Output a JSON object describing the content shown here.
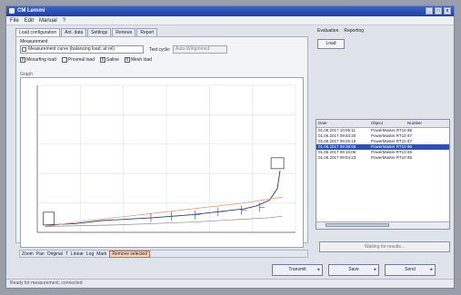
{
  "window": {
    "title": "CM Lemmi",
    "buttons": [
      "_",
      "□",
      "x"
    ]
  },
  "menu": {
    "items": [
      "File",
      "Edit",
      "Manual",
      "?"
    ]
  },
  "tabs": [
    {
      "label": "Load configuration"
    },
    {
      "label": "Ant. data"
    },
    {
      "label": "Settings"
    },
    {
      "label": "Renews"
    },
    {
      "label": "Report"
    }
  ],
  "panel": {
    "measurement_label": "Measurement",
    "measurement_value": "Measurement curve (balancing load, at rel)",
    "test_cycle_label": "Test cycle:",
    "test_cycle_value": "Auto-Wingmmed",
    "checks": [
      {
        "label": "Mesurfing load",
        "checked": "x"
      },
      {
        "label": "Proxmal load",
        "checked": ""
      },
      {
        "label": "Saline",
        "checked": "x"
      },
      {
        "label": "Mesh load",
        "checked": "x"
      }
    ],
    "graph_label": "Graph"
  },
  "chart_data": {
    "type": "line",
    "title": "",
    "xlabel": "",
    "ylabel": "",
    "xlim": [
      0,
      100
    ],
    "ylim": [
      0,
      100
    ],
    "grid": true,
    "series": [
      {
        "color": "#2c3e74",
        "x": [
          3,
          15,
          25,
          45,
          60,
          70,
          80,
          85,
          90,
          93,
          94
        ],
        "y": [
          5,
          6,
          8,
          10,
          12,
          14,
          16,
          18,
          22,
          30,
          42
        ]
      },
      {
        "color": "#d89a7a",
        "x": [
          3,
          20,
          40,
          60,
          80,
          95
        ],
        "y": [
          4,
          8,
          12,
          16,
          20,
          24
        ]
      },
      {
        "color": "#8a8a8a",
        "x": [
          3,
          30,
          60,
          90,
          95
        ],
        "y": [
          4,
          5,
          7,
          10,
          11
        ]
      }
    ],
    "markers": [
      {
        "x": 44,
        "y": 10
      },
      {
        "x": 52,
        "y": 11
      },
      {
        "x": 61,
        "y": 12
      },
      {
        "x": 70,
        "y": 14
      },
      {
        "x": 79,
        "y": 15
      },
      {
        "x": 86,
        "y": 17
      }
    ],
    "annotation_box": {
      "x": 93,
      "y": 47
    }
  },
  "bottom_strip": {
    "items": [
      "Zoom",
      "Pan",
      "Original",
      "T",
      "Linear",
      "Log",
      "Mark"
    ],
    "highlight": "Remove selected"
  },
  "right": {
    "tabs": [
      "Evaluation",
      "Reporting"
    ],
    "load_button": "Load",
    "list": {
      "headers": [
        "Date",
        "Object",
        "Number"
      ],
      "rows": [
        {
          "date": "01.06.2017 10:05:11",
          "object": "PowerMaster RT10",
          "number": "88",
          "selected": false
        },
        {
          "date": "01.06.2017 09:53:30",
          "object": "PowerMaster RT10",
          "number": "87",
          "selected": false
        },
        {
          "date": "01.06.2017 09:45:18",
          "object": "PowerMaster RT10",
          "number": "87",
          "selected": false
        },
        {
          "date": "01.06.2017 09:38:58",
          "object": "PowerMaster RT10",
          "number": "86",
          "selected": true
        },
        {
          "date": "01.06.2017 09:15:06",
          "object": "PowerMaster RT10",
          "number": "85",
          "selected": false
        },
        {
          "date": "01.06.2017 09:04:23",
          "object": "PowerMaster RT10",
          "number": "85",
          "selected": false
        }
      ]
    },
    "report_button": "Waiting for results..."
  },
  "actions": {
    "buttons": [
      "Transmit",
      "Save",
      "Send"
    ]
  },
  "status": {
    "text": "Ready for measurement, connected"
  }
}
